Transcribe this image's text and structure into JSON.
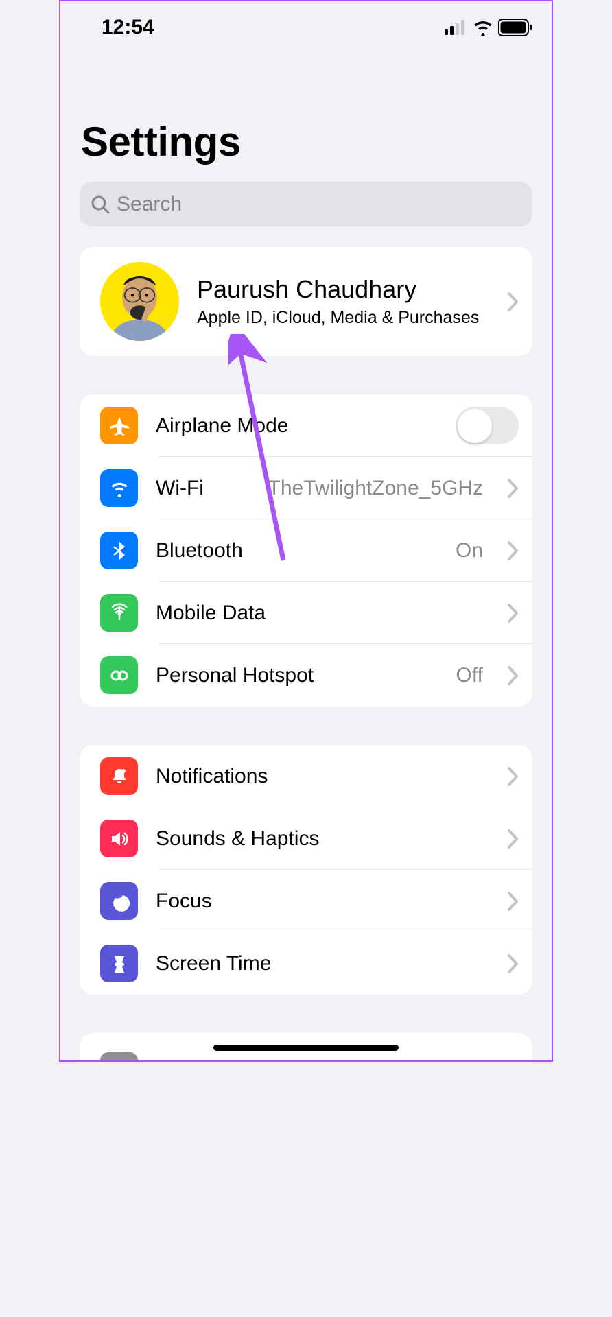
{
  "status": {
    "time": "12:54"
  },
  "header": {
    "title": "Settings"
  },
  "search": {
    "placeholder": "Search"
  },
  "profile": {
    "name": "Paurush Chaudhary",
    "subtitle": "Apple ID, iCloud, Media & Purchases"
  },
  "group1": {
    "airplane": {
      "label": "Airplane Mode"
    },
    "wifi": {
      "label": "Wi-Fi",
      "value": "TheTwilightZone_5GHz"
    },
    "bluetooth": {
      "label": "Bluetooth",
      "value": "On"
    },
    "mobile": {
      "label": "Mobile Data"
    },
    "hotspot": {
      "label": "Personal Hotspot",
      "value": "Off"
    }
  },
  "group2": {
    "notifications": {
      "label": "Notifications"
    },
    "sounds": {
      "label": "Sounds & Haptics"
    },
    "focus": {
      "label": "Focus"
    },
    "screentime": {
      "label": "Screen Time"
    }
  }
}
